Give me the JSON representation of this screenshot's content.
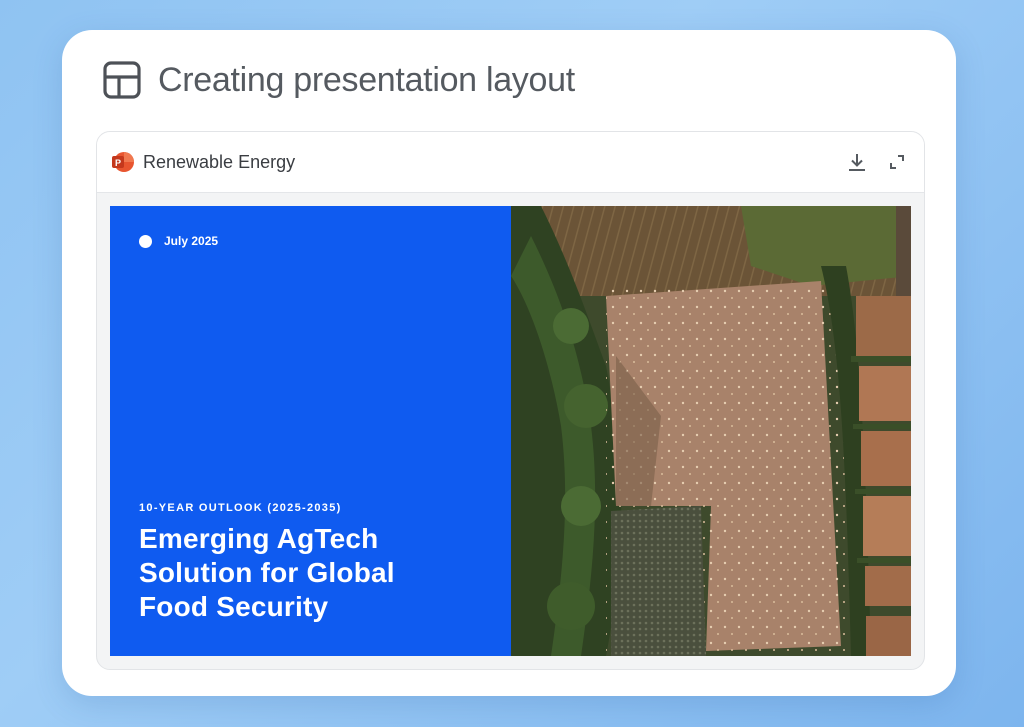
{
  "card": {
    "title": "Creating presentation layout",
    "icon": "layout-grid-icon"
  },
  "viewer": {
    "file_name": "Renewable Energy",
    "file_icon": "powerpoint-icon",
    "actions": [
      "download-icon",
      "expand-icon"
    ]
  },
  "slide": {
    "date": "July 2025",
    "eyebrow": "10-YEAR OUTLOOK (2025-2035)",
    "title": "Emerging AgTech Solution for Global Food Security",
    "accent_color": "#0f5bf0"
  },
  "controls": {
    "prev_icon": "chevron-left-icon",
    "play_icon": "play-icon",
    "next_icon": "chevron-right-icon"
  }
}
